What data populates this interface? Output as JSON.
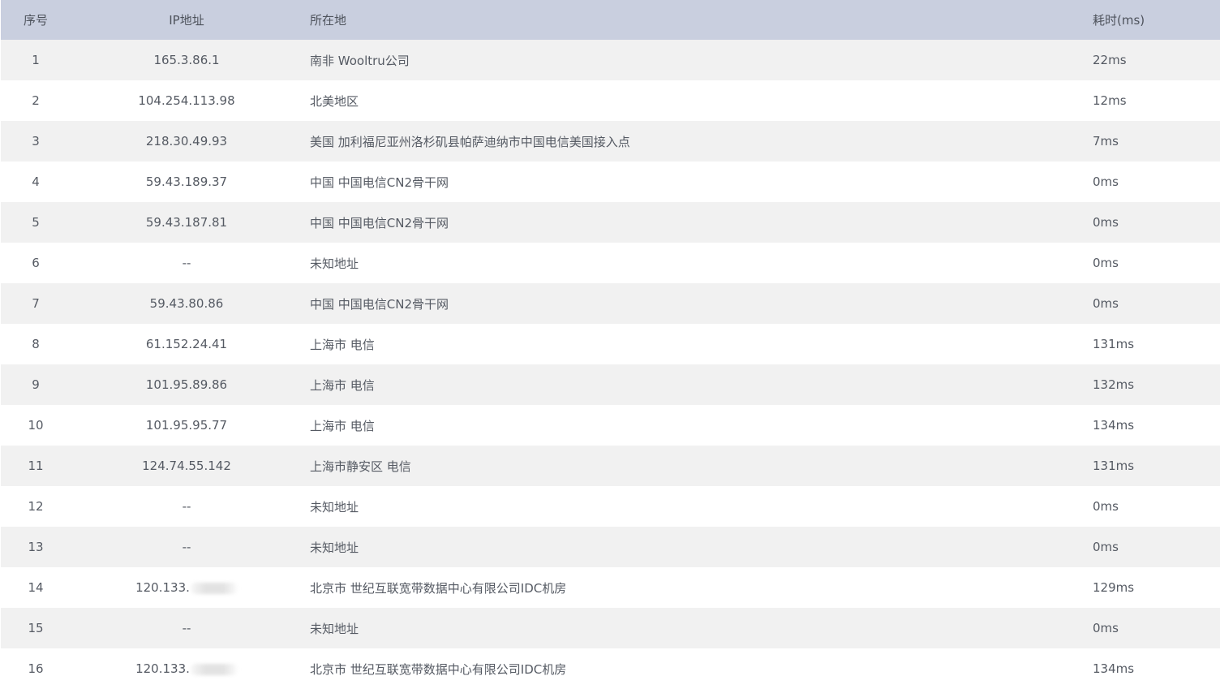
{
  "table": {
    "headers": {
      "index": "序号",
      "ip": "IP地址",
      "location": "所在地",
      "time": "耗时(ms)"
    },
    "rows": [
      {
        "index": "1",
        "ip": "165.3.86.1",
        "location": "南非 Wooltru公司",
        "time": "22ms"
      },
      {
        "index": "2",
        "ip": "104.254.113.98",
        "location": "北美地区",
        "time": "12ms"
      },
      {
        "index": "3",
        "ip": "218.30.49.93",
        "location": "美国 加利福尼亚州洛杉矶县帕萨迪纳市中国电信美国接入点",
        "time": "7ms"
      },
      {
        "index": "4",
        "ip": "59.43.189.37",
        "location": "中国 中国电信CN2骨干网",
        "time": "0ms"
      },
      {
        "index": "5",
        "ip": "59.43.187.81",
        "location": "中国 中国电信CN2骨干网",
        "time": "0ms"
      },
      {
        "index": "6",
        "ip": "--",
        "location": "未知地址",
        "time": "0ms"
      },
      {
        "index": "7",
        "ip": "59.43.80.86",
        "location": "中国 中国电信CN2骨干网",
        "time": "0ms"
      },
      {
        "index": "8",
        "ip": "61.152.24.41",
        "location": "上海市 电信",
        "time": "131ms"
      },
      {
        "index": "9",
        "ip": "101.95.89.86",
        "location": "上海市 电信",
        "time": "132ms"
      },
      {
        "index": "10",
        "ip": "101.95.95.77",
        "location": "上海市 电信",
        "time": "134ms"
      },
      {
        "index": "11",
        "ip": "124.74.55.142",
        "location": "上海市静安区 电信",
        "time": "131ms"
      },
      {
        "index": "12",
        "ip": "--",
        "location": "未知地址",
        "time": "0ms"
      },
      {
        "index": "13",
        "ip": "--",
        "location": "未知地址",
        "time": "0ms"
      },
      {
        "index": "14",
        "ip": "120.133.",
        "location": "北京市 世纪互联宽带数据中心有限公司IDC机房",
        "time": "129ms"
      },
      {
        "index": "15",
        "ip": "--",
        "location": "未知地址",
        "time": "0ms"
      },
      {
        "index": "16",
        "ip": "120.133.",
        "location": "北京市 世纪互联宽带数据中心有限公司IDC机房",
        "time": "134ms"
      }
    ]
  },
  "colors": {
    "header_bg": "#c9cfdf",
    "row_odd_bg": "#f1f1f1",
    "row_even_bg": "#ffffff",
    "text": "#555a63"
  }
}
